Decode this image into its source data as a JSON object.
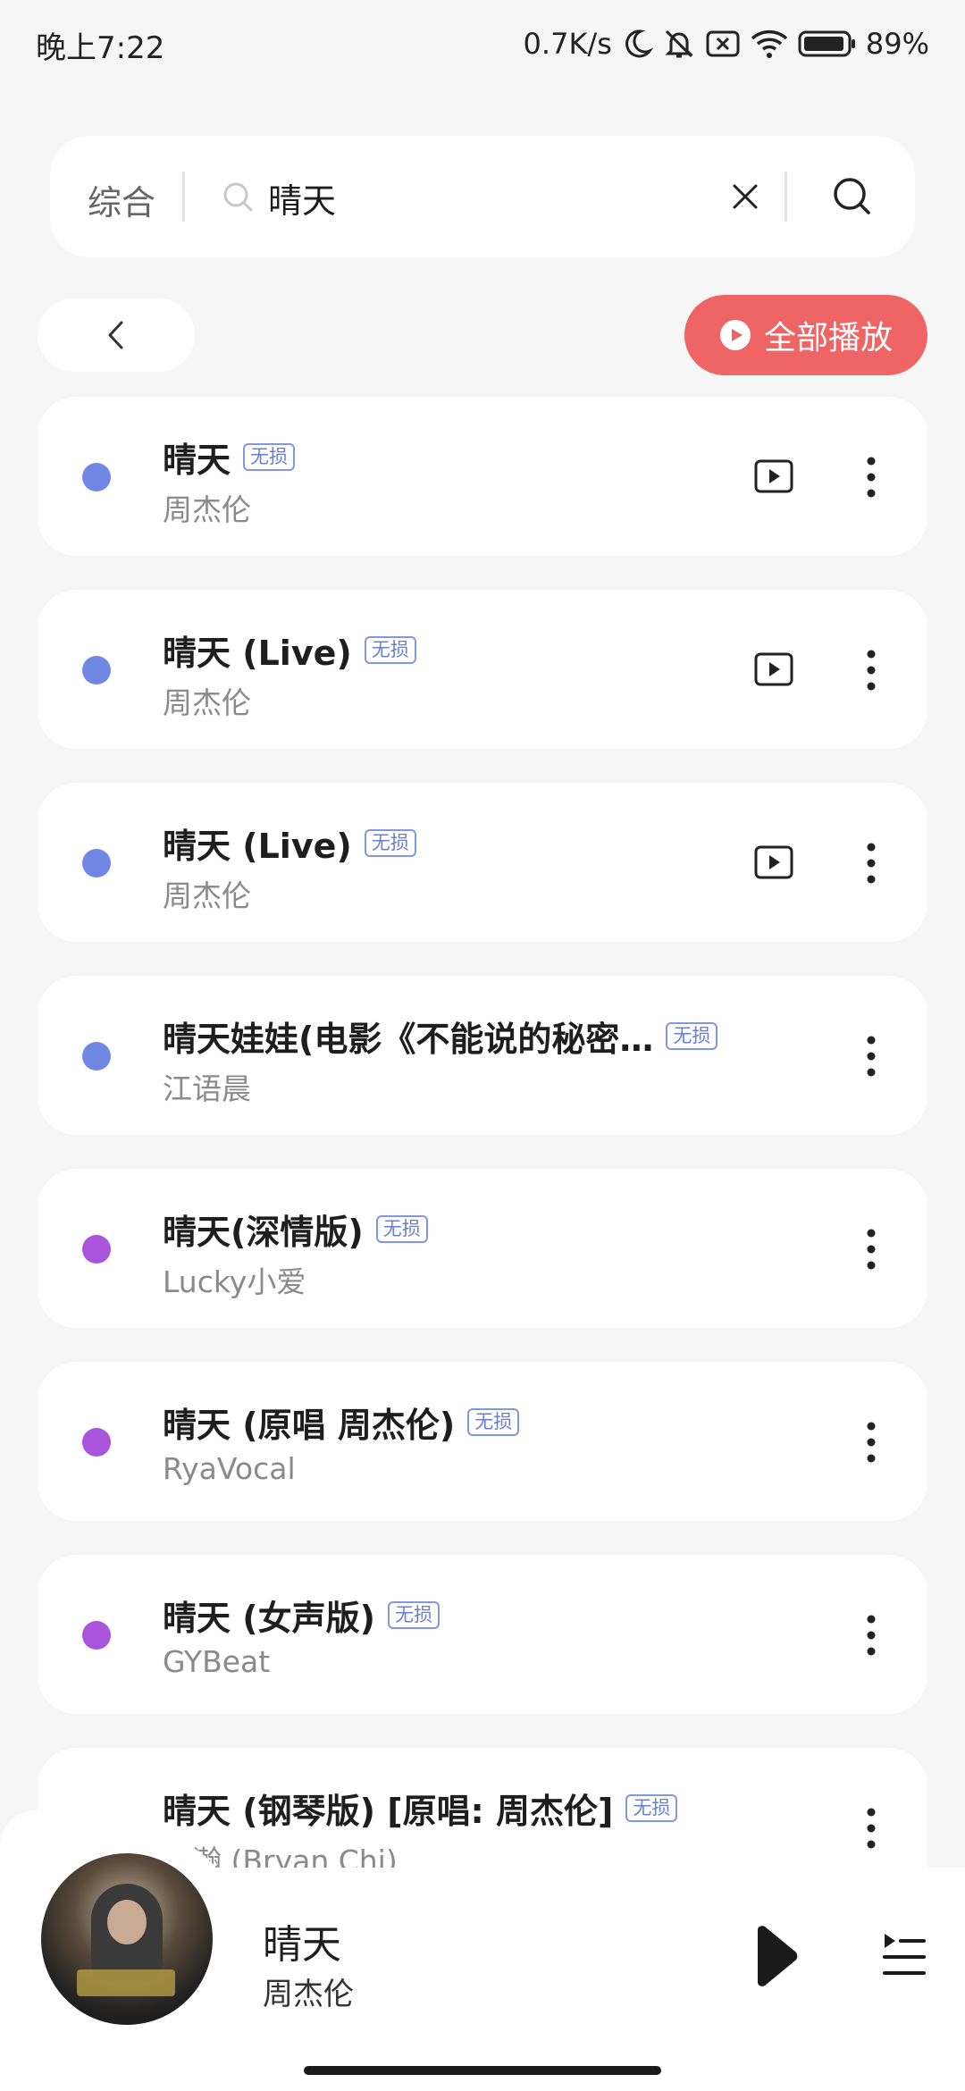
{
  "status_bar": {
    "time": "晚上7:22",
    "net_speed": "0.7K/s",
    "battery": "89%",
    "icons": [
      "moon-icon",
      "mute-bell-icon",
      "sim-off-icon",
      "wifi-icon",
      "battery-icon"
    ]
  },
  "search": {
    "category": "综合",
    "query": "晴天"
  },
  "actions": {
    "play_all_label": "全部播放",
    "accent_color": "#ef6464"
  },
  "badge_label": "无损",
  "songs": [
    {
      "title": "晴天",
      "artist": "周杰伦",
      "dot_color": "#7088e4",
      "has_mv": true
    },
    {
      "title": "晴天 (Live)",
      "artist": "周杰伦",
      "dot_color": "#7088e4",
      "has_mv": true
    },
    {
      "title": "晴天 (Live)",
      "artist": "周杰伦",
      "dot_color": "#7088e4",
      "has_mv": true
    },
    {
      "title": "晴天娃娃(电影《不能说的秘密…",
      "artist": "江语晨",
      "dot_color": "#7088e4",
      "has_mv": false
    },
    {
      "title": "晴天(深情版)",
      "artist": "Lucky小爱",
      "dot_color": "#a855dc",
      "has_mv": false
    },
    {
      "title": "晴天 (原唱 周杰伦)",
      "artist": "RyaVocal",
      "dot_color": "#a855dc",
      "has_mv": false
    },
    {
      "title": "晴天 (女声版)",
      "artist": "GYBeat",
      "dot_color": "#a855dc",
      "has_mv": false
    },
    {
      "title": "晴天 (钢琴版) [原唱: 周杰伦]",
      "artist": "…瀚 (Bryan Chi)",
      "dot_color": "#a855dc",
      "has_mv": false
    }
  ],
  "now_playing": {
    "title": "晴天",
    "artist": "周杰伦"
  }
}
